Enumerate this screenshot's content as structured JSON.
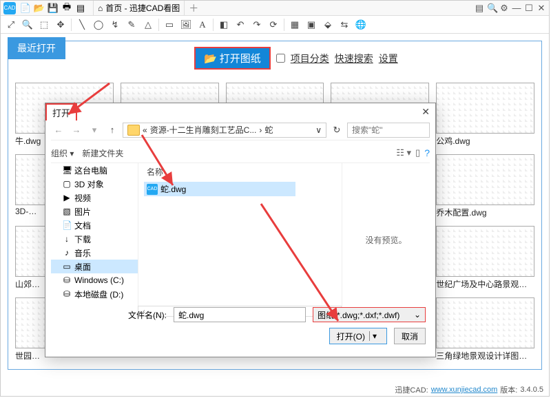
{
  "titlebar": {
    "home_icon": "⌂",
    "tab_title": "首页 - 迅捷CAD看图",
    "plus": "＋"
  },
  "recent_label": "最近打开",
  "open_drawing": "打开图纸",
  "hdr": {
    "category": "项目分类",
    "quicksearch": "快速搜索",
    "settings": "设置"
  },
  "thumbs": [
    "牛.dwg",
    "",
    "",
    "",
    "公鸡.dwg",
    "3D-…",
    "",
    "",
    "",
    "乔木配置.dwg",
    "山郊…",
    "",
    "",
    "",
    "世纪广场及中心路景观…",
    "世园…",
    "",
    "",
    "",
    "三角绿地景观设计详图…"
  ],
  "dialog": {
    "title": "打开",
    "back": "←",
    "fwd": "→",
    "up": "↑",
    "path_parts": [
      "资源-十二生肖雕刻工艺品C...",
      "蛇"
    ],
    "path_dd": "∨",
    "refresh": "↻",
    "search_ph": "搜索\"蛇\"",
    "organize": "组织 ▾",
    "newfolder": "新建文件夹",
    "view_icon": "☷ ▾",
    "panel_icon": "▯",
    "help": "?",
    "col_name": "名称",
    "tree": [
      {
        "label": "这台电脑",
        "ic": "🖥"
      },
      {
        "label": "3D 对象",
        "ic": "▢"
      },
      {
        "label": "视频",
        "ic": "▶"
      },
      {
        "label": "图片",
        "ic": "▧"
      },
      {
        "label": "文档",
        "ic": "📄"
      },
      {
        "label": "下载",
        "ic": "↓"
      },
      {
        "label": "音乐",
        "ic": "♪"
      },
      {
        "label": "桌面",
        "ic": "▭",
        "selected": true
      },
      {
        "label": "Windows (C:)",
        "ic": "⛁"
      },
      {
        "label": "本地磁盘 (D:)",
        "ic": "⛁"
      }
    ],
    "file": "蛇.dwg",
    "no_preview": "没有预览。",
    "fname_label": "文件名(N):",
    "fname_value": "蛇.dwg",
    "filter": "图纸(*.dwg;*.dxf;*.dwf)",
    "open_btn": "打开(O)",
    "open_dd": "▾",
    "cancel_btn": "取消"
  },
  "status": {
    "prefix": "迅捷CAD:",
    "url": "www.xunjiecad.com",
    "ver_label": "版本:",
    "ver": "3.4.0.5"
  }
}
